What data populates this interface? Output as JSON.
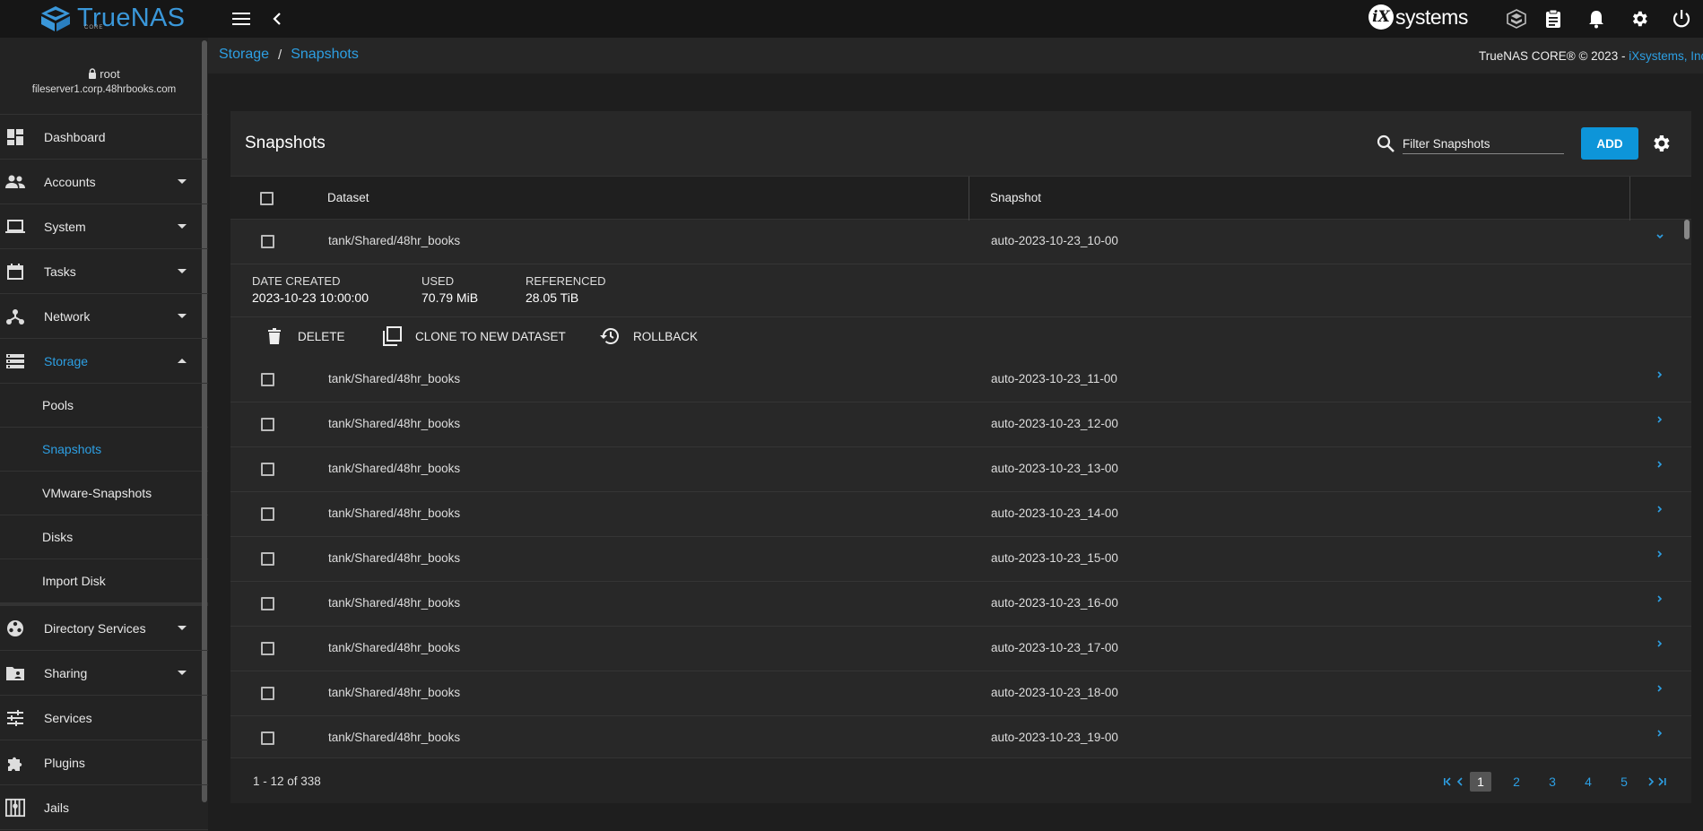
{
  "topbar": {
    "brand": "TrueNAS",
    "brand_sub": "CORE",
    "vendor_mark": "iX",
    "vendor_text": "systems"
  },
  "user": {
    "name": "root",
    "host": "fileserver1.corp.48hrbooks.com"
  },
  "sidebar": {
    "items": [
      {
        "label": "Dashboard"
      },
      {
        "label": "Accounts"
      },
      {
        "label": "System"
      },
      {
        "label": "Tasks"
      },
      {
        "label": "Network"
      },
      {
        "label": "Storage"
      }
    ],
    "storage_sub": [
      {
        "label": "Pools"
      },
      {
        "label": "Snapshots"
      },
      {
        "label": "VMware-Snapshots"
      },
      {
        "label": "Disks"
      },
      {
        "label": "Import Disk"
      }
    ],
    "lower_items": [
      {
        "label": "Directory Services"
      },
      {
        "label": "Sharing"
      },
      {
        "label": "Services"
      },
      {
        "label": "Plugins"
      },
      {
        "label": "Jails"
      }
    ]
  },
  "breadcrumb": {
    "parent": "Storage",
    "sep": "/",
    "current": "Snapshots"
  },
  "copyright": {
    "text": "TrueNAS CORE® © 2023 - ",
    "link": "iXsystems, Inc"
  },
  "card": {
    "title": "Snapshots",
    "filter_placeholder": "Filter Snapshots",
    "add_label": "ADD"
  },
  "table": {
    "columns": [
      "Dataset",
      "Snapshot"
    ],
    "expanded": {
      "dataset": "tank/Shared/48hr_books",
      "snapshot": "auto-2023-10-23_10-00",
      "date_created_label": "DATE CREATED",
      "date_created": "2023-10-23 10:00:00",
      "used_label": "USED",
      "used": "70.79 MiB",
      "referenced_label": "REFERENCED",
      "referenced": "28.05 TiB",
      "actions": {
        "delete": "DELETE",
        "clone": "CLONE TO NEW DATASET",
        "rollback": "ROLLBACK"
      }
    },
    "rows": [
      {
        "dataset": "tank/Shared/48hr_books",
        "snapshot": "auto-2023-10-23_11-00"
      },
      {
        "dataset": "tank/Shared/48hr_books",
        "snapshot": "auto-2023-10-23_12-00"
      },
      {
        "dataset": "tank/Shared/48hr_books",
        "snapshot": "auto-2023-10-23_13-00"
      },
      {
        "dataset": "tank/Shared/48hr_books",
        "snapshot": "auto-2023-10-23_14-00"
      },
      {
        "dataset": "tank/Shared/48hr_books",
        "snapshot": "auto-2023-10-23_15-00"
      },
      {
        "dataset": "tank/Shared/48hr_books",
        "snapshot": "auto-2023-10-23_16-00"
      },
      {
        "dataset": "tank/Shared/48hr_books",
        "snapshot": "auto-2023-10-23_17-00"
      },
      {
        "dataset": "tank/Shared/48hr_books",
        "snapshot": "auto-2023-10-23_18-00"
      },
      {
        "dataset": "tank/Shared/48hr_books",
        "snapshot": "auto-2023-10-23_19-00"
      }
    ]
  },
  "pagination": {
    "range": "1 - 12 of 338",
    "pages": [
      "1",
      "2",
      "3",
      "4",
      "5"
    ],
    "current": "1"
  },
  "colors": {
    "accent": "#0d95d9",
    "link": "#2d9fe3"
  }
}
